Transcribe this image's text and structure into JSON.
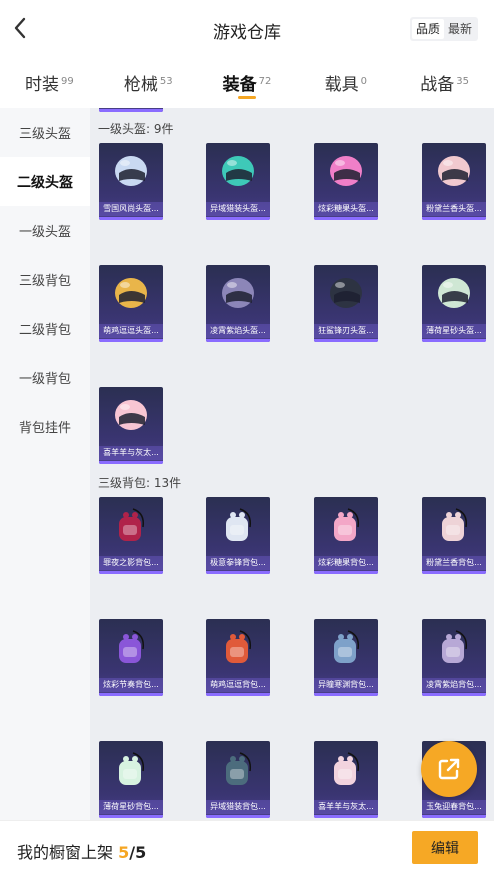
{
  "header": {
    "title": "游戏仓库",
    "back_icon": "chevron-left-icon",
    "sort_options": [
      "品质",
      "最新"
    ],
    "sort_selected": "品质"
  },
  "tabs": [
    {
      "label": "时装",
      "count": "99"
    },
    {
      "label": "枪械",
      "count": "53"
    },
    {
      "label": "装备",
      "count": "72",
      "active": true
    },
    {
      "label": "载具",
      "count": "0"
    },
    {
      "label": "战备",
      "count": "35"
    }
  ],
  "sidebar": {
    "items": [
      "三级头盔",
      "二级头盔",
      "一级头盔",
      "三级背包",
      "二级背包",
      "一级背包",
      "背包挂件"
    ],
    "active": "二级头盔"
  },
  "sections": [
    {
      "title": "一级头盔: 9件",
      "items": [
        {
          "name": "雪国风尚头盔...",
          "color": "#c9d9f2"
        },
        {
          "name": "异域猎装头盔...",
          "color": "#3ec9b8"
        },
        {
          "name": "炫彩糖果头盔...",
          "color": "#f07fc8"
        },
        {
          "name": "粉黛兰香头盔...",
          "color": "#f1c9cf"
        },
        {
          "name": "萌鸡逗逗头盔...",
          "color": "#e9b54a"
        },
        {
          "name": "凌霄紫焰头盔...",
          "color": "#8c86b8"
        },
        {
          "name": "狂鲨锋刃头盔...",
          "color": "#2d3342"
        },
        {
          "name": "薄荷星砂头盔...",
          "color": "#cfe7d4"
        },
        {
          "name": "喜羊羊与灰太...",
          "color": "#f8c6d3"
        }
      ]
    },
    {
      "title": "三级背包: 13件",
      "items": [
        {
          "name": "罪夜之影背包...",
          "color": "#b0234a"
        },
        {
          "name": "极意拳锋背包...",
          "color": "#dfe6f2"
        },
        {
          "name": "炫彩糖果背包...",
          "color": "#f3a7c7"
        },
        {
          "name": "粉黛兰香背包...",
          "color": "#eed3d7"
        },
        {
          "name": "炫彩节奏背包...",
          "color": "#8a56d8"
        },
        {
          "name": "萌鸡逗逗背包...",
          "color": "#e05a3a"
        },
        {
          "name": "异瞳寒渊背包...",
          "color": "#7ea1c9"
        },
        {
          "name": "凌霄紫焰背包...",
          "color": "#b7a8d6"
        },
        {
          "name": "薄荷星砂背包...",
          "color": "#d7f2e0"
        },
        {
          "name": "异域猎装背包...",
          "color": "#4c6c7d"
        },
        {
          "name": "喜羊羊与灰太...",
          "color": "#f2d3de"
        },
        {
          "name": "玉兔迎春背包...",
          "color": "#e8e8f0"
        }
      ]
    }
  ],
  "floating_button": {
    "icon": "share-external-icon"
  },
  "bottom_bar": {
    "label": "我的橱窗上架",
    "count": "5",
    "total": "/5",
    "edit_label": "编辑"
  },
  "colors": {
    "accent": "#f6a825",
    "card_bg": "#2b2f52"
  }
}
